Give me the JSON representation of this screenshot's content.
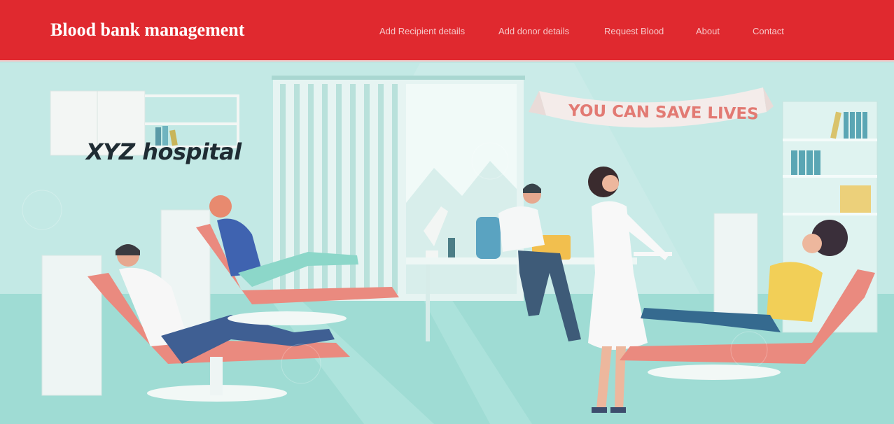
{
  "header": {
    "brand": "Blood bank management",
    "nav": [
      {
        "label": "Add Recipient details"
      },
      {
        "label": "Add donor details"
      },
      {
        "label": "Request Blood"
      },
      {
        "label": "About"
      },
      {
        "label": "Contact"
      }
    ]
  },
  "hero": {
    "title": "XYZ hospital",
    "banner_text": "YOU CAN SAVE LIVES"
  },
  "colors": {
    "header_bg": "#e0292f",
    "nav_text": "#f6c7c8",
    "hero_bg": "#bfe6e2",
    "chair": "#ea8a7f"
  }
}
